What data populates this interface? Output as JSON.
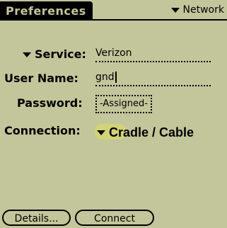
{
  "header": {
    "title": "Preferences",
    "menu_label": "Network"
  },
  "form": {
    "service": {
      "label": "Service:",
      "value": "Verizon"
    },
    "username": {
      "label": "User Name:",
      "value": "gnd"
    },
    "password": {
      "label": "Password:",
      "value": "-Assigned-"
    },
    "connection": {
      "label": "Connection:",
      "value": "Cradle / Cable"
    }
  },
  "buttons": {
    "details": "Details...",
    "connect": "Connect"
  },
  "colors": {
    "background": "#c3c69a",
    "foreground": "#000000",
    "highlight": "#d9d96a"
  }
}
